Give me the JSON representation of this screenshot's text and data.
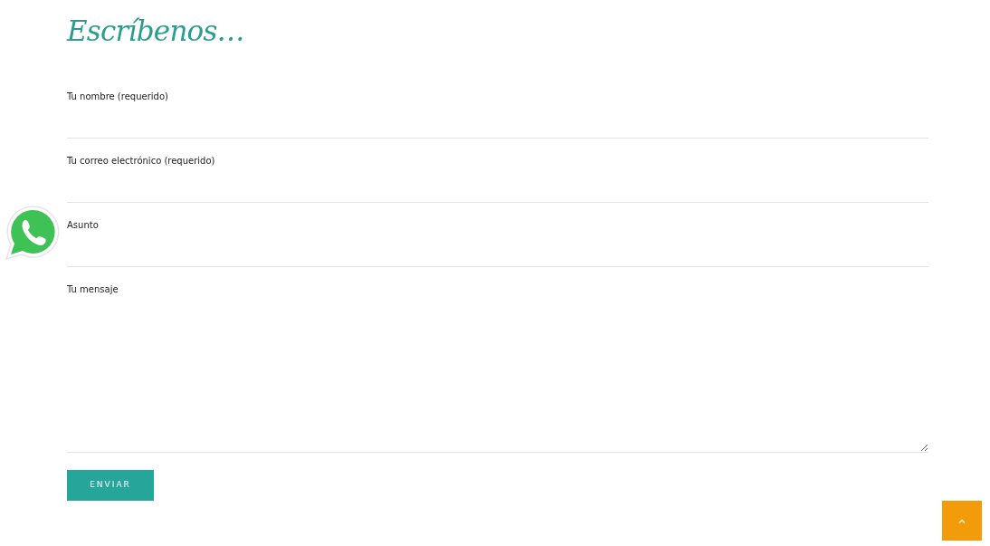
{
  "heading": "Escríbenos…",
  "fields": [
    {
      "label": "Tu nombre (requerido)",
      "kind": "input"
    },
    {
      "label": "Tu correo electrónico (requerido)",
      "kind": "input"
    },
    {
      "label": "Asunto",
      "kind": "input"
    },
    {
      "label": "Tu mensaje",
      "kind": "textarea"
    }
  ],
  "submit": "ENVIAR"
}
